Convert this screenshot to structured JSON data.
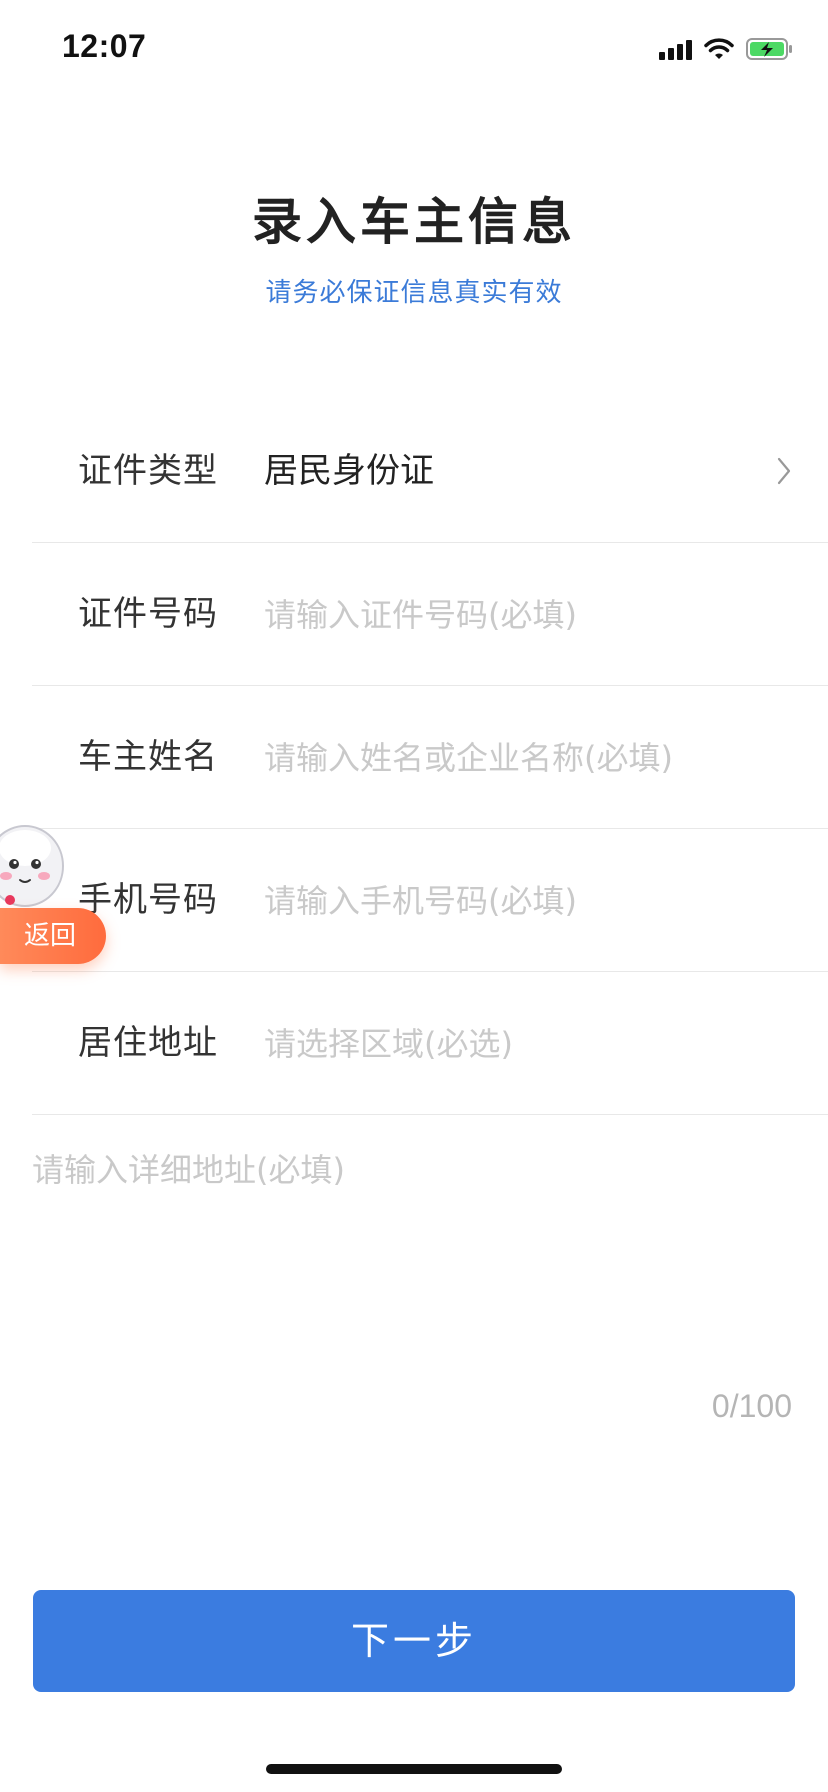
{
  "status_bar": {
    "time": "12:07"
  },
  "header": {
    "title": "录入车主信息",
    "subtitle": "请务必保证信息真实有效"
  },
  "form": {
    "id_type": {
      "label": "证件类型",
      "value": "居民身份证"
    },
    "id_number": {
      "label": "证件号码",
      "placeholder": "请输入证件号码(必填)"
    },
    "owner_name": {
      "label": "车主姓名",
      "placeholder": "请输入姓名或企业名称(必填)"
    },
    "phone": {
      "label": "手机号码",
      "placeholder": "请输入手机号码(必填)"
    },
    "residence": {
      "label": "居住地址",
      "placeholder": "请选择区域(必选)"
    },
    "address_detail": {
      "placeholder": "请输入详细地址(必填)",
      "counter": "0/100"
    }
  },
  "next_button": {
    "label": "下一步"
  },
  "floating_back": {
    "label": "返回"
  },
  "colors": {
    "accent": "#3b7ce0",
    "subtitle": "#3b7bd8",
    "placeholder": "#c9c9c9",
    "back_pill": "#ff7a4a"
  },
  "icons": [
    "cellular-signal-icon",
    "wifi-icon",
    "battery-charging-icon",
    "chevron-right-icon",
    "mascot-icon"
  ]
}
